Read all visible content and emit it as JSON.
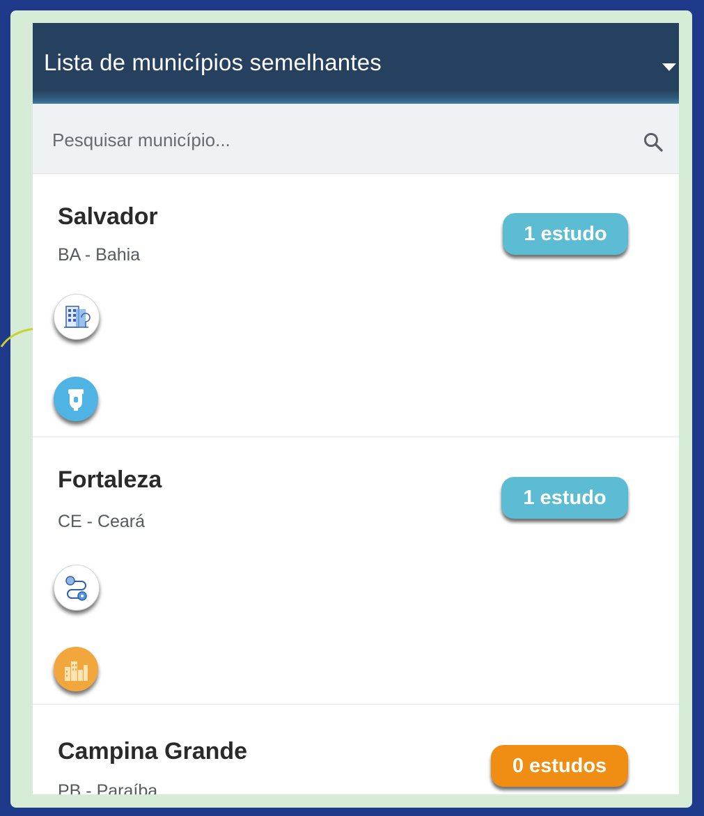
{
  "header": {
    "title": "Lista de municípios semelhantes"
  },
  "search": {
    "placeholder": "Pesquisar município..."
  },
  "municipios": [
    {
      "name": "Salvador",
      "state": "BA - Bahia",
      "badge": "1 estudo",
      "badge_color": "#5bbcd3",
      "icons": [
        "building-icon",
        "faucet-icon"
      ]
    },
    {
      "name": "Fortaleza",
      "state": "CE - Ceará",
      "badge": "1 estudo",
      "badge_color": "#5bbcd3",
      "icons": [
        "route-icon",
        "city-skyline-icon"
      ]
    },
    {
      "name": "Campina Grande",
      "state": "PB - Paraíba",
      "badge": "0 estudos",
      "badge_color": "#ef8e12",
      "icons": []
    }
  ],
  "colors": {
    "background": "#1f3a8a",
    "frame": "#d6ecd6",
    "header": "#26405f",
    "pointer": "#c9d42b"
  }
}
